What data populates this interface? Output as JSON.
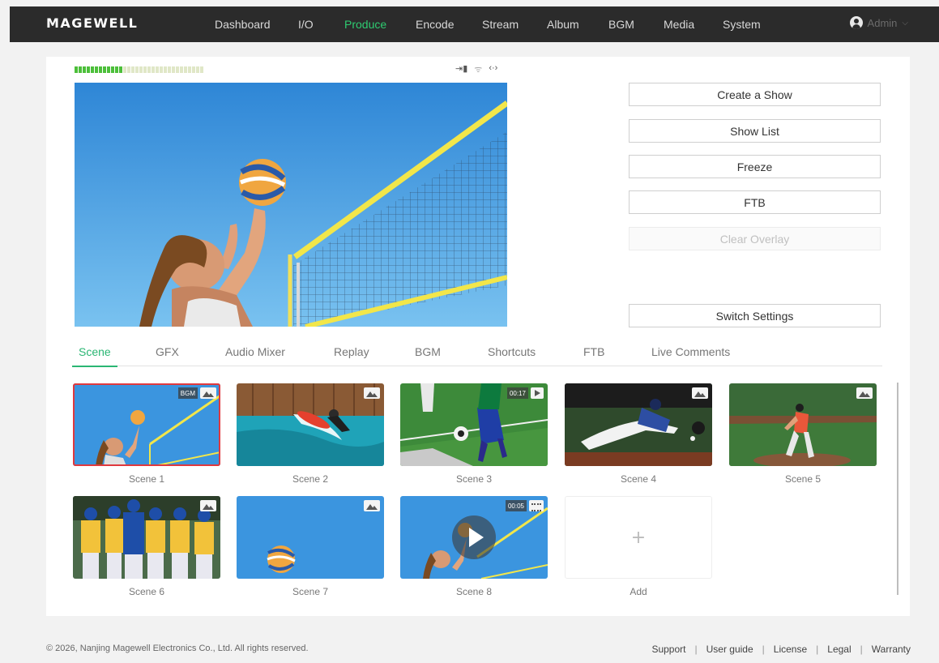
{
  "brand": "MAGEWELL",
  "nav": [
    "Dashboard",
    "I/O",
    "Produce",
    "Encode",
    "Stream",
    "Album",
    "BGM",
    "Media",
    "System"
  ],
  "nav_active": "Produce",
  "user": {
    "name": "Admin",
    "chevron": "⌵"
  },
  "status_icons": [
    "⇥▮",
    "ᯤ",
    "‹·›"
  ],
  "audio_meter": {
    "segments": 32,
    "lit": 12
  },
  "controls": {
    "create_show": "Create a Show",
    "show_list": "Show List",
    "freeze": "Freeze",
    "ftb": "FTB",
    "clear_overlay": "Clear Overlay",
    "switch_settings": "Switch Settings"
  },
  "tabs": [
    "Scene",
    "GFX",
    "Audio Mixer",
    "Replay",
    "BGM",
    "Shortcuts",
    "FTB",
    "Live Comments"
  ],
  "tab_active": "Scene",
  "scenes": [
    {
      "label": "Scene 1",
      "badge": "BGM",
      "type": "image"
    },
    {
      "label": "Scene 2",
      "type": "image"
    },
    {
      "label": "Scene 3",
      "badge": "00:17",
      "type": "video"
    },
    {
      "label": "Scene 4",
      "type": "image"
    },
    {
      "label": "Scene 5",
      "type": "image"
    },
    {
      "label": "Scene 6",
      "type": "image"
    },
    {
      "label": "Scene 7",
      "type": "image"
    },
    {
      "label": "Scene 8",
      "badge": "00:05",
      "type": "video"
    }
  ],
  "add_label": "Add",
  "add_symbol": "+",
  "footer": {
    "copyright": "© 2026, Nanjing Magewell Electronics Co., Ltd. All rights reserved.",
    "links": [
      "Support",
      "User guide",
      "License",
      "Legal",
      "Warranty"
    ]
  },
  "colors": {
    "accent": "#2ab673",
    "selected_border": "#e0393e",
    "topbar": "#2b2b2b"
  }
}
